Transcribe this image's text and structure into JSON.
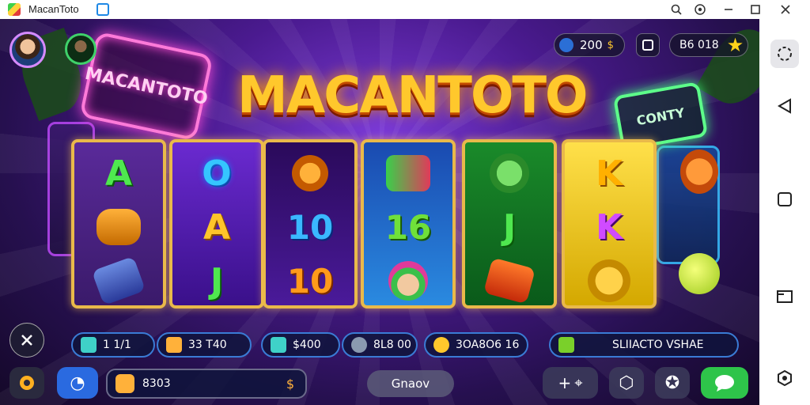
{
  "window": {
    "title": "MacanToto"
  },
  "game": {
    "logo": "MACANTOTO",
    "neon_sign_left": "MACANTOTO",
    "neon_sign_right": "CONTY",
    "top_stats": {
      "coins": "200",
      "gems": "B6 018"
    },
    "reels": [
      {
        "symbols": [
          "A",
          "",
          ""
        ]
      },
      {
        "symbols": [
          "O",
          "A",
          "J"
        ]
      },
      {
        "symbols": [
          "",
          "10",
          "10"
        ]
      },
      {
        "symbols": [
          "",
          "16",
          ""
        ]
      },
      {
        "symbols": [
          "",
          "J",
          ""
        ]
      },
      {
        "symbols": [
          "K",
          "K",
          ""
        ]
      }
    ],
    "info_bar": {
      "lines": "1 1/1",
      "bet": "33 T40",
      "win": "$400",
      "shield_value": "8L8 00",
      "coin_total": "3OA8O6 16",
      "status_text": "SLIIACTO VSHAE"
    },
    "bottom": {
      "balance": "8303",
      "center_button": "Gnaov"
    }
  },
  "colors": {
    "accent_gold": "#ffc82c",
    "panel_blue": "#3a7bd5",
    "chat_green": "#2ec44a"
  },
  "icons": [
    "app-icon",
    "pin-icon",
    "search-icon",
    "settings-icon",
    "minimize-icon",
    "maximize-icon",
    "close-icon"
  ]
}
